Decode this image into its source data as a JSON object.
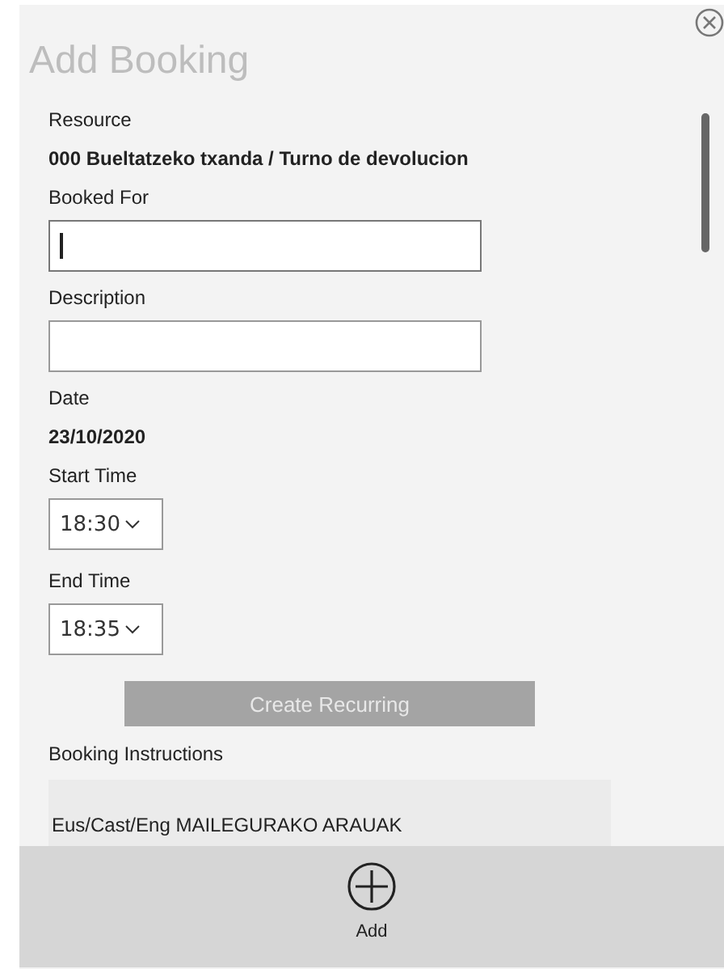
{
  "dialog": {
    "title": "Add Booking"
  },
  "fields": [
    {
      "kind": "static",
      "label": "Resource",
      "value": "000 Bueltatzeko txanda / Turno de devolucion"
    },
    {
      "kind": "text",
      "label": "Booked For",
      "focused": true
    },
    {
      "kind": "text",
      "label": "Description",
      "focused": false
    },
    {
      "kind": "static",
      "label": "Date",
      "value": "23/10/2020"
    },
    {
      "kind": "select",
      "label": "Start Time",
      "value": "18:30"
    },
    {
      "kind": "select",
      "label": "End Time",
      "value": "18:35"
    }
  ],
  "recurring_button": {
    "label": "Create Recurring",
    "disabled": true
  },
  "instructions": {
    "label": "Booking Instructions",
    "text": "Eus/Cast/Eng MAILEGURAKO ARAUAK"
  },
  "footer": {
    "add_label": "Add"
  }
}
